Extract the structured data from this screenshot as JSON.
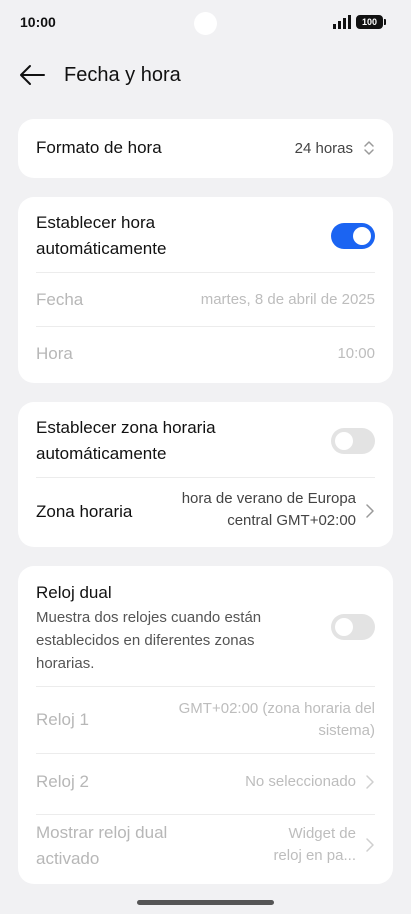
{
  "status_bar": {
    "time": "10:00",
    "battery": "100"
  },
  "header": {
    "title": "Fecha y hora"
  },
  "time_format": {
    "label": "Formato de hora",
    "value": "24 horas"
  },
  "auto_time": {
    "label_line1": "Establecer hora",
    "label_line2": "automáticamente",
    "enabled": true,
    "date_label": "Fecha",
    "date_value": "martes, 8 de abril de 2025",
    "time_label": "Hora",
    "time_value": "10:00"
  },
  "auto_timezone": {
    "label_line1": "Establecer zona horaria",
    "label_line2": "automáticamente",
    "enabled": false,
    "timezone_label": "Zona horaria",
    "timezone_value_line1": "hora de verano de Europa",
    "timezone_value_line2": "central GMT+02:00"
  },
  "dual_clock": {
    "label": "Reloj dual",
    "desc_line1": "Muestra dos relojes cuando están",
    "desc_line2": "establecidos en diferentes zonas",
    "desc_line3": "horarias.",
    "enabled": false,
    "clock1_label": "Reloj 1",
    "clock1_value_line1": "GMT+02:00 (zona horaria del",
    "clock1_value_line2": "sistema)",
    "clock2_label": "Reloj 2",
    "clock2_value": "No seleccionado",
    "show_label_line1": "Mostrar reloj dual",
    "show_label_line2": "activado",
    "show_value_line1": "Widget de",
    "show_value_line2": "reloj en pa..."
  }
}
